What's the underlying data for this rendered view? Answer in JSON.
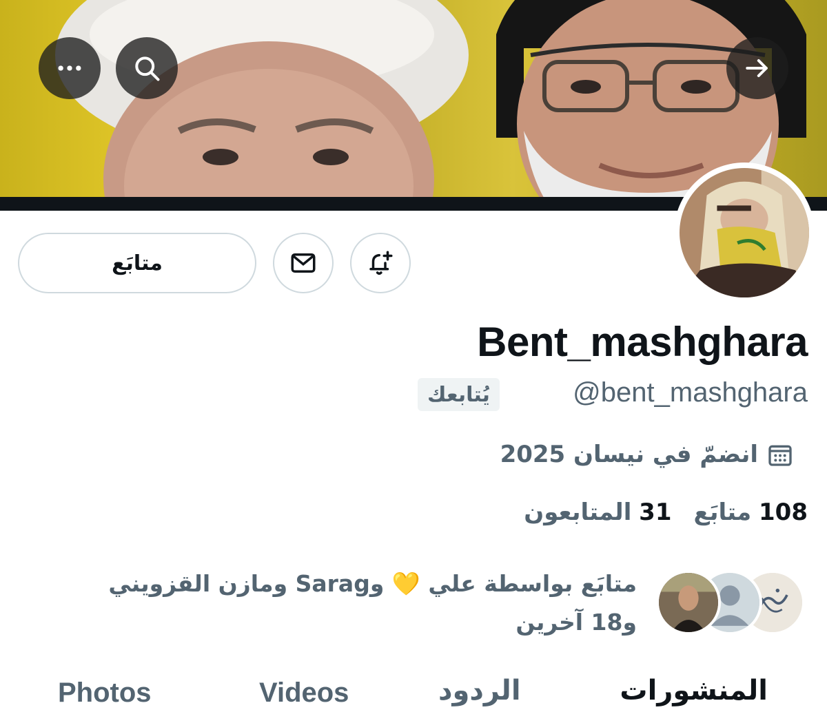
{
  "header": {
    "more_icon": "more-horizontal-icon",
    "search_icon": "search-icon",
    "forward_icon": "arrow-right-icon"
  },
  "actions": {
    "follow_label": "متابَع",
    "message_icon": "mail-icon",
    "notify_icon": "bell-plus-icon"
  },
  "profile": {
    "display_name": "Bent_mashghara",
    "handle": "@bent_mashghara",
    "follows_you_badge": "يُتابعك",
    "joined_text": "انضمّ في نيسان 2025",
    "following_count": "108",
    "following_label": "متابَع",
    "followers_count": "31",
    "followers_label": "المتابعون",
    "followed_by_text": "متابَع بواسطة علي 💛 وSarag ومازن القزويني و18 آخرين"
  },
  "tabs": [
    {
      "label": "المنشورات",
      "active": true
    },
    {
      "label": "الردود",
      "active": false
    },
    {
      "label": "Videos",
      "active": false
    },
    {
      "label": "Photos",
      "active": false
    }
  ],
  "colors": {
    "text_primary": "#0f1419",
    "text_secondary": "#536471",
    "border": "#cfd9de",
    "badge_bg": "#eff3f4",
    "banner_yellow": "#d9c33a"
  }
}
